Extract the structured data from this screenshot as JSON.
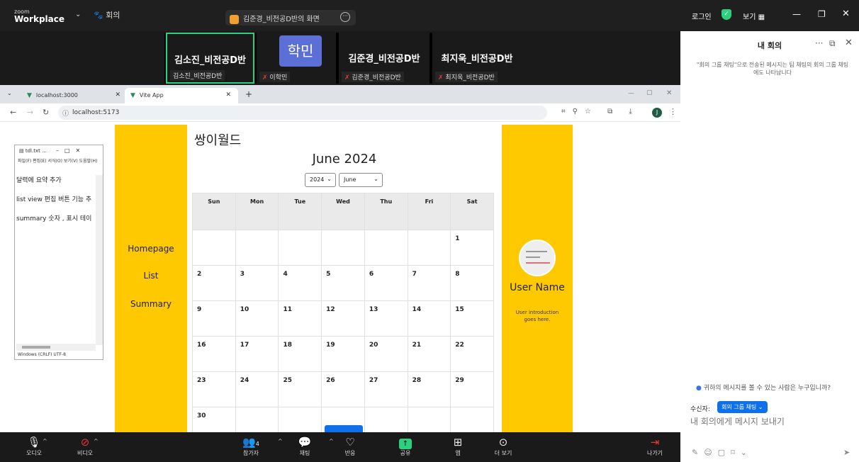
{
  "zoom": {
    "logo_small": "zoom",
    "logo_big": "Workplace",
    "meeting_label": "회의",
    "share_title": "김준경_비전공D반의 화면",
    "right_top": {
      "login": "로그인",
      "view": "보기"
    },
    "participants": [
      {
        "name": "김소진_비전공D반",
        "tag": "김소진_비전공D반",
        "muted": false
      },
      {
        "name": "학민",
        "tag": "이학민",
        "muted": true
      },
      {
        "name": "김준경_비전공D반",
        "tag": "김준경_비전공D반",
        "muted": true
      },
      {
        "name": "최지욱_비전공D반",
        "tag": "최지욱_비전공D반",
        "muted": true
      }
    ],
    "toolbar": {
      "audio": "오디오",
      "video": "비디오",
      "participants": "참가자",
      "participants_count": "4",
      "chat": "채팅",
      "reactions": "반응",
      "share": "공유",
      "apps": "앱",
      "more": "더 보기",
      "leave": "나가기"
    },
    "chat": {
      "title": "내 회의",
      "note": "\"회의 그룹 채팅\"으로 전송된 메시지는 팀 채팅의 회의 그룹 채팅에도 나타납니다",
      "who": "귀하의 메시지를 볼 수 있는 사람은 누구입니까?",
      "recipient_label": "수신자:",
      "recipient_value": "회의 그룹 채팅",
      "input_placeholder": "내 회의에게 메시지 보내기"
    }
  },
  "browser": {
    "tabs": [
      {
        "title": "localhost:3000",
        "active": false
      },
      {
        "title": "Vite App",
        "active": true
      }
    ],
    "url": "localhost:5173",
    "profile_initial": "J"
  },
  "app": {
    "name": "쌍이월드",
    "nav": [
      "Homepage",
      "List",
      "Summary"
    ],
    "calendar": {
      "title": "June 2024",
      "year": "2024",
      "month": "June",
      "weekdays": [
        "Sun",
        "Mon",
        "Tue",
        "Wed",
        "Thu",
        "Fri",
        "Sat"
      ],
      "weeks": [
        [
          "",
          "",
          "",
          "",
          "",
          "",
          "1"
        ],
        [
          "2",
          "3",
          "4",
          "5",
          "6",
          "7",
          "8"
        ],
        [
          "9",
          "10",
          "11",
          "12",
          "13",
          "14",
          "15"
        ],
        [
          "16",
          "17",
          "18",
          "19",
          "20",
          "21",
          "22"
        ],
        [
          "23",
          "24",
          "25",
          "26",
          "27",
          "28",
          "29"
        ],
        [
          "30",
          "",
          "",
          "",
          "",
          "",
          ""
        ]
      ]
    },
    "user": {
      "name": "User Name",
      "intro": "User introduction goes here."
    }
  },
  "notepad": {
    "title": "tdl.txt ...",
    "menu": "파일(F)  편집(E)  서식(O)  보기(V)  도움말(H)",
    "lines": [
      "달력에 요약 추가",
      "list view 편집 버튼 기능 추",
      "summary 숫자 , 표시 테이"
    ],
    "status": "Windows (CRLF)  UTF-8"
  }
}
